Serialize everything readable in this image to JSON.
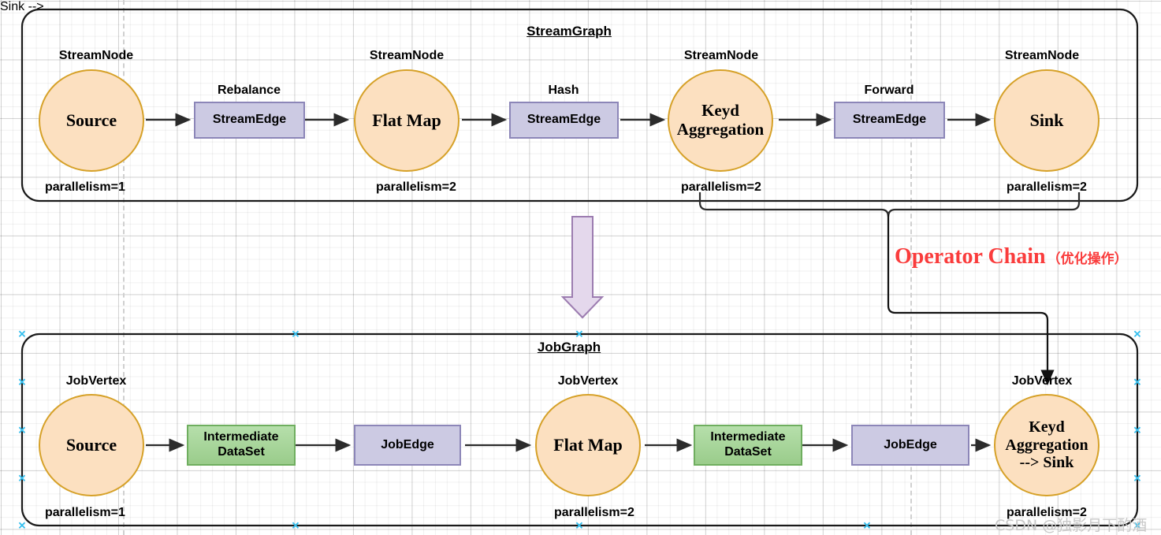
{
  "diagram": {
    "watermark": "CSDN @独影月下酌酒",
    "annotation": {
      "en": "Operator Chain",
      "zh": "（优化操作）",
      "color": "#FA3C3C"
    },
    "transform_arrow": "down-block-arrow",
    "colors": {
      "circle_fill": "#FCE0C0",
      "circle_stroke": "#D6A128",
      "edge_box_fill": "#CCCAE3",
      "edge_box_stroke": "#8C86B8",
      "dataset_fill": "#9ACC8B",
      "dataset_stroke": "#6FAE5F",
      "block_arrow_fill": "#E4D8EC",
      "block_arrow_stroke": "#9C7CB0",
      "container_stroke": "#1A1A1A",
      "handle": "#36BFEE"
    }
  },
  "streamgraph": {
    "title": "StreamGraph",
    "node_type_label": "StreamNode",
    "edge_type_label": "StreamEdge",
    "nodes": [
      {
        "name": "Source",
        "type": "StreamNode",
        "parallelism": "parallelism=1"
      },
      {
        "name": "Flat Map",
        "type": "StreamNode",
        "parallelism": "parallelism=2"
      },
      {
        "name": "Keyd\nAggregation",
        "type": "StreamNode",
        "parallelism": "parallelism=2"
      },
      {
        "name": "Sink",
        "type": "StreamNode",
        "parallelism": "parallelism=2"
      }
    ],
    "edges": [
      {
        "strategy": "Rebalance",
        "label": "StreamEdge"
      },
      {
        "strategy": "Hash",
        "label": "StreamEdge"
      },
      {
        "strategy": "Forward",
        "label": "StreamEdge"
      }
    ]
  },
  "jobgraph": {
    "title": "JobGraph",
    "node_type_label": "JobVertex",
    "nodes": [
      {
        "name": "Source",
        "type": "JobVertex",
        "parallelism": "parallelism=1"
      },
      {
        "name": "Flat Map",
        "type": "JobVertex",
        "parallelism": "parallelism=2"
      },
      {
        "name": "Keyd\nAggregation\n--> Sink",
        "type": "JobVertex",
        "parallelism": "parallelism=2"
      }
    ],
    "datasets": [
      {
        "label": "Intermediate\nDataSet"
      },
      {
        "label": "Intermediate\nDataSet"
      }
    ],
    "edges": [
      {
        "label": "JobEdge"
      },
      {
        "label": "JobEdge"
      }
    ]
  }
}
